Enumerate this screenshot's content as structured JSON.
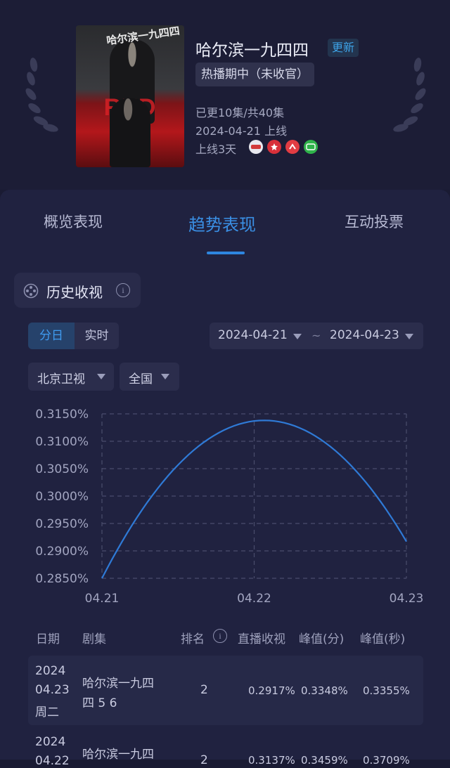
{
  "show": {
    "title": "哈尔滨一九四四",
    "update_badge": "更新",
    "status": "热播期中（未收官）",
    "episodes": "已更10集/共40集",
    "release": "2024-04-21 上线",
    "days_online": "上线3天",
    "poster_calligraphy": "哈尔滨一九四四",
    "platforms": [
      {
        "icon": "cctv-icon",
        "color": "#e8e8ef"
      },
      {
        "icon": "mango-icon",
        "color": "#d8303a"
      },
      {
        "icon": "youku-icon",
        "color": "#e23c43"
      },
      {
        "icon": "iqiyi-icon",
        "color": "#2fb24a"
      }
    ]
  },
  "tabs": {
    "overview": "概览表现",
    "trend": "趋势表现",
    "interaction": "互动投票"
  },
  "section": {
    "title": "历史收视",
    "info": "i"
  },
  "filters": {
    "mode_day": "分日",
    "mode_realtime": "实时",
    "date_from": "2024-04-21",
    "date_separator": "~",
    "date_to": "2024-04-23",
    "channel": "北京卫视",
    "region": "全国"
  },
  "chart_data": {
    "type": "line",
    "x": [
      "04.21",
      "04.22",
      "04.23"
    ],
    "series": [
      {
        "values": [
          0.285,
          0.3137,
          0.2917
        ]
      }
    ],
    "y_ticks": [
      "0.3150%",
      "0.3100%",
      "0.3050%",
      "0.3000%",
      "0.2950%",
      "0.2900%",
      "0.2850%"
    ],
    "ylim": [
      0.285,
      0.315
    ],
    "grid": true,
    "line_color": "#2f7ad6"
  },
  "table": {
    "headers": {
      "date": "日期",
      "episode": "剧集",
      "rank": "排名",
      "rank_info": "i",
      "live": "直播收视",
      "peak_min": "峰值(分)",
      "peak_sec": "峰值(秒)"
    },
    "rows": [
      {
        "year": "2024",
        "md": "04.23",
        "weekday": "周二",
        "episode_line1": "哈尔滨一九四",
        "episode_line2": "四 5 6",
        "rank": "2",
        "live": "0.2917%",
        "peak_min": "0.3348%",
        "peak_sec": "0.3355%"
      },
      {
        "year": "2024",
        "md": "04.22",
        "weekday": "",
        "episode_line1": "哈尔滨一九四",
        "episode_line2": "",
        "rank": "2",
        "live": "0.3137%",
        "peak_min": "0.3459%",
        "peak_sec": "0.3709%"
      }
    ]
  }
}
